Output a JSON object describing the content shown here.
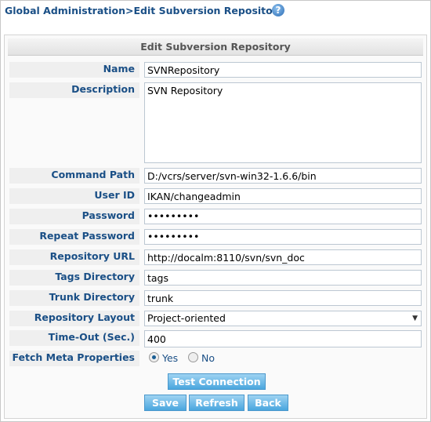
{
  "breadcrumb": "Global Administration>Edit Subversion Repository",
  "help_icon": "?",
  "panel_title": "Edit Subversion Repository",
  "fields": {
    "name": {
      "label": "Name",
      "value": "SVNRepository"
    },
    "description": {
      "label": "Description",
      "value": "SVN Repository"
    },
    "command_path": {
      "label": "Command Path",
      "value": "D:/vcrs/server/svn-win32-1.6.6/bin"
    },
    "user_id": {
      "label": "User ID",
      "value": "IKAN/changeadmin"
    },
    "password": {
      "label": "Password",
      "value": "•••••••••"
    },
    "repeat_password": {
      "label": "Repeat Password",
      "value": "•••••••••"
    },
    "repository_url": {
      "label": "Repository URL",
      "value": "http://docalm:8110/svn/svn_doc"
    },
    "tags_directory": {
      "label": "Tags Directory",
      "value": "tags"
    },
    "trunk_directory": {
      "label": "Trunk Directory",
      "value": "trunk"
    },
    "repository_layout": {
      "label": "Repository Layout",
      "value": "Project-oriented"
    },
    "timeout": {
      "label": "Time-Out (Sec.)",
      "value": "400"
    },
    "fetch_meta": {
      "label": "Fetch Meta Properties",
      "options": [
        "Yes",
        "No"
      ],
      "selected": "Yes"
    }
  },
  "buttons": {
    "test": "Test Connection",
    "save": "Save",
    "refresh": "Refresh",
    "back": "Back"
  }
}
